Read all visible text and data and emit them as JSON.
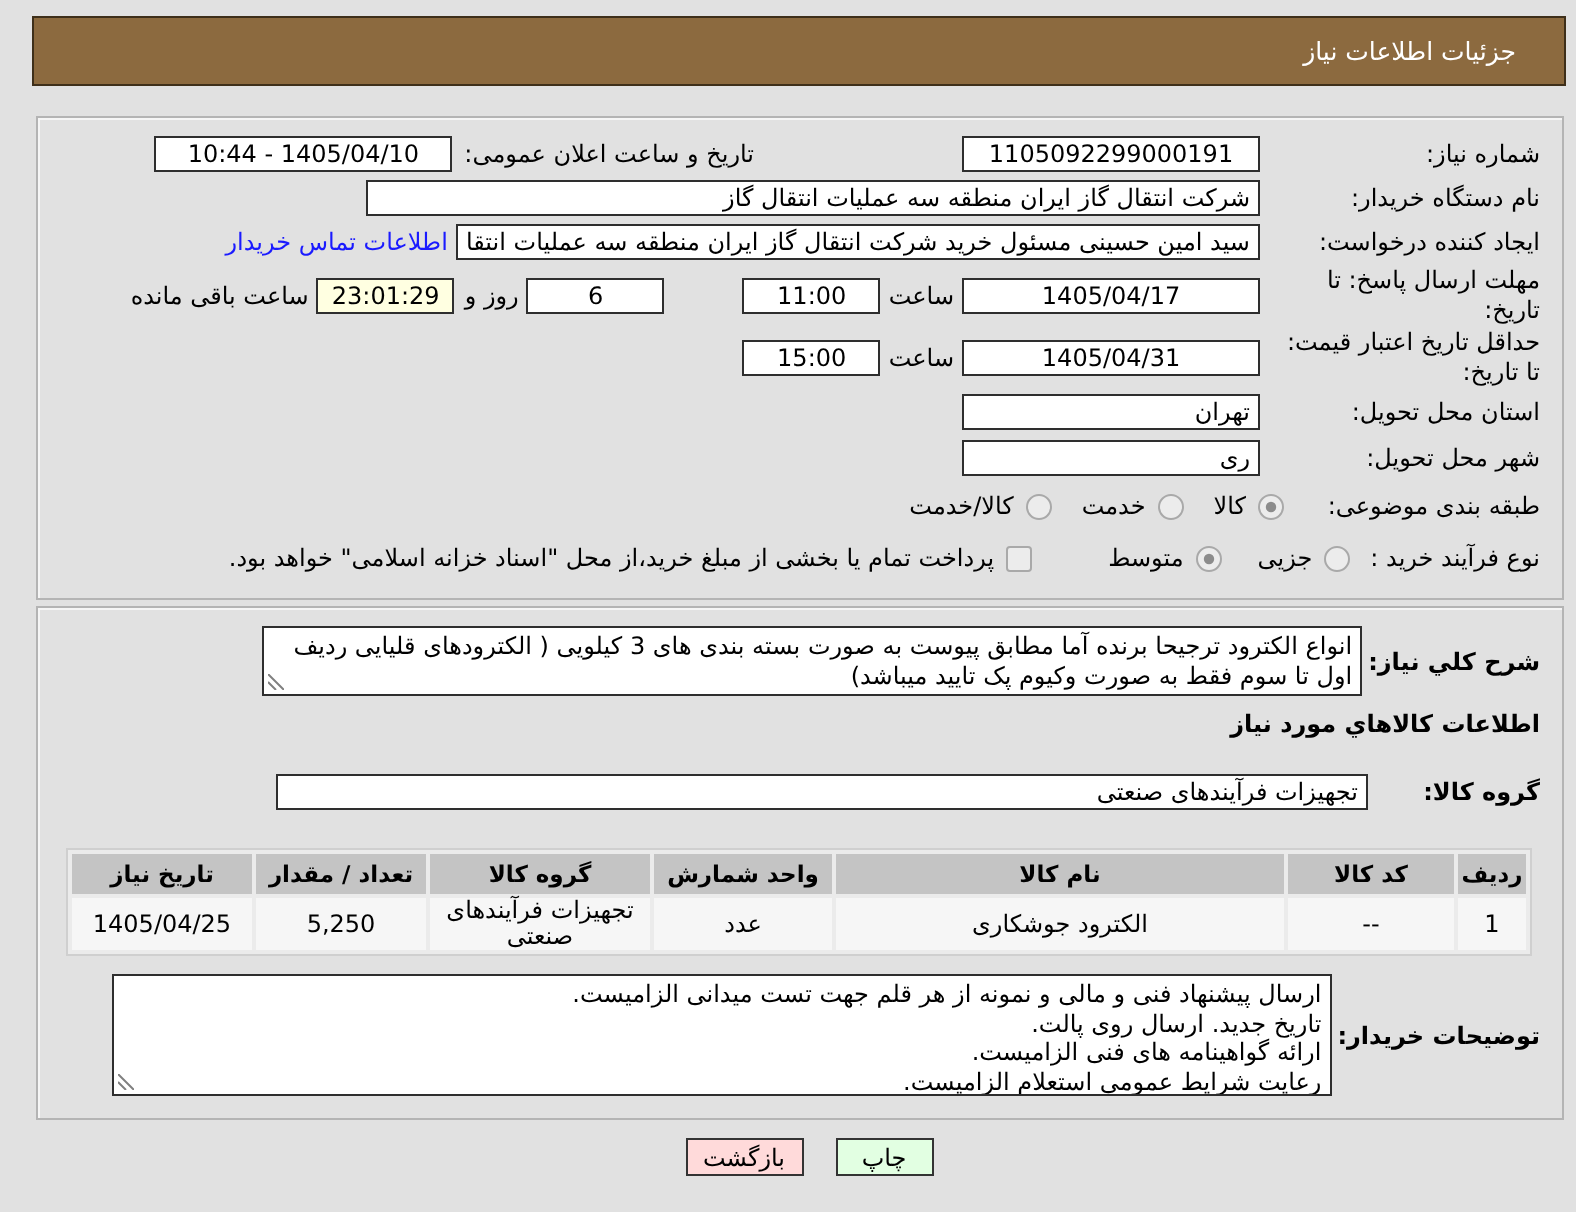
{
  "header": {
    "title": "جزئیات اطلاعات نیاز"
  },
  "details": {
    "need_number": {
      "label": "شماره نیاز:",
      "value": "1105092299000191"
    },
    "announcement": {
      "label": "تاریخ و ساعت اعلان عمومی:",
      "value": "1405/04/10 - 10:44"
    },
    "buyer_org": {
      "label": "نام دستگاه خریدار:",
      "value": "شرکت انتقال گاز ایران منطقه سه عملیات انتقال گاز"
    },
    "requester": {
      "label": "ایجاد کننده درخواست:",
      "value": "سید امین حسینی مسئول خرید شرکت انتقال گاز ایران منطقه سه عملیات انتقا",
      "link": "اطلاعات تماس خریدار"
    },
    "reply_deadline": {
      "label": "مهلت ارسال پاسخ: تا تاریخ:",
      "date": "1405/04/17",
      "time_label": "ساعت",
      "time": "11:00",
      "days": "6",
      "days_label": "روز و",
      "remaining": "23:01:29",
      "remaining_label": "ساعت باقی مانده"
    },
    "price_validity": {
      "label": "حداقل تاریخ اعتبار قیمت: تا تاریخ:",
      "date": "1405/04/31",
      "time_label": "ساعت",
      "time": "15:00"
    },
    "province": {
      "label": "استان محل تحویل:",
      "value": "تهران"
    },
    "city": {
      "label": "شهر محل تحویل:",
      "value": "ری"
    },
    "category": {
      "label": "طبقه بندی موضوعی:",
      "options": [
        {
          "label": "کالا",
          "selected": true
        },
        {
          "label": "خدمت",
          "selected": false
        },
        {
          "label": "کالا/خدمت",
          "selected": false
        }
      ]
    },
    "purchase_type": {
      "label": "نوع فرآیند خرید :",
      "options": [
        {
          "label": "جزیی",
          "selected": false
        },
        {
          "label": "متوسط",
          "selected": true
        }
      ],
      "treasury": {
        "label": "پرداخت تمام یا بخشی از مبلغ خرید،از محل \"اسناد خزانه اسلامی\" خواهد بود.",
        "checked": false
      }
    }
  },
  "description": {
    "label": "شرح کلي نیاز:",
    "value": "انواع الکترود ترجیحا برنده آما مطابق پیوست به صورت بسته بندی های 3 کیلویی ( الکترودهای قلیایی ردیف اول تا سوم فقط به صورت وکیوم پک تایید میباشد)"
  },
  "goods": {
    "title": "اطلاعات کالاهاي مورد نیاز",
    "group_label": "گروه کالا:",
    "group_value": "تجهیزات فرآیندهای صنعتی",
    "table": {
      "columns": [
        "ردیف",
        "کد کالا",
        "نام کالا",
        "واحد شمارش",
        "گروه کالا",
        "تعداد / مقدار",
        "تاریخ نیاز"
      ],
      "rows": [
        [
          "1",
          "--",
          "الکترود جوشکاری",
          "عدد",
          "تجهیزات فرآیندهای صنعتی",
          "5,250",
          "1405/04/25"
        ]
      ]
    }
  },
  "buyer_notes": {
    "label": "توضیحات خریدار:",
    "lines": [
      "ارسال پیشنهاد فنی و مالی و نمونه از هر قلم جهت تست میدانی الزامیست.",
      "تاریخ جدید. ارسال روی پالت.",
      "ارائه گواهینامه های فنی الزامیست.",
      "رعایت شرایط عمومی استعلام الزامیست."
    ]
  },
  "buttons": [
    {
      "label": "چاپ",
      "kind": "print"
    },
    {
      "label": "بازگشت",
      "kind": "back"
    }
  ]
}
